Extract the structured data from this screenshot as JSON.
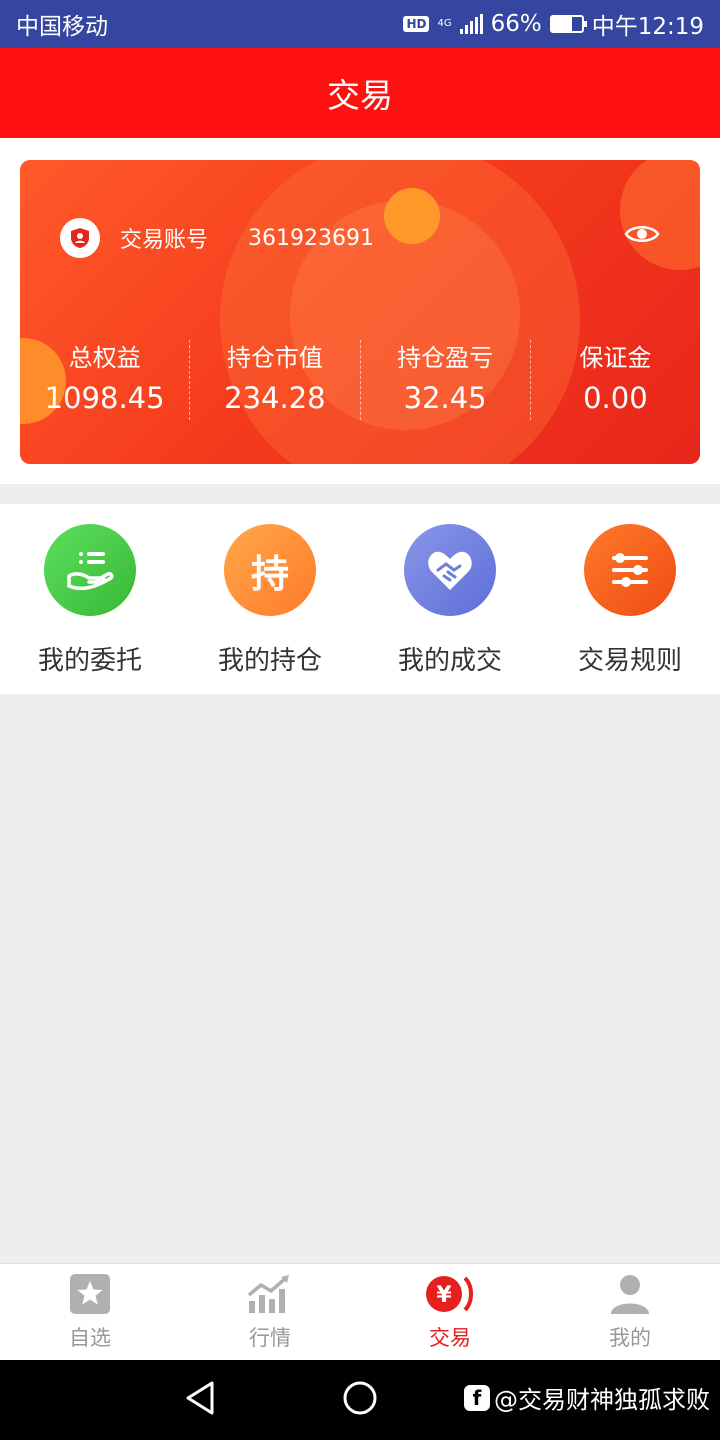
{
  "status_bar": {
    "carrier": "中国移动",
    "hd": "HD",
    "network": "4G",
    "battery": "66%",
    "battery_level": 0.66,
    "time": "中午12:19"
  },
  "header": {
    "title": "交易"
  },
  "account": {
    "label": "交易账号",
    "number": "361923691",
    "stats": [
      {
        "label": "总权益",
        "value": "1098.45"
      },
      {
        "label": "持仓市值",
        "value": "234.28"
      },
      {
        "label": "持仓盈亏",
        "value": "32.45"
      },
      {
        "label": "保证金",
        "value": "0.00"
      }
    ]
  },
  "shortcuts": [
    {
      "label": "我的委托",
      "icon": "hand-list-icon",
      "color": "#4ccb4c"
    },
    {
      "label": "我的持仓",
      "icon": "持",
      "color": "#ff8a3a"
    },
    {
      "label": "我的成交",
      "icon": "handshake-heart-icon",
      "color": "#6f7fdc"
    },
    {
      "label": "交易规则",
      "icon": "sliders-icon",
      "color": "#f25a1c"
    }
  ],
  "tabbar": {
    "active": "交易",
    "tabs": [
      {
        "label": "自选",
        "icon": "star-icon"
      },
      {
        "label": "行情",
        "icon": "chart-trend-icon"
      },
      {
        "label": "交易",
        "icon": "yen-icon"
      },
      {
        "label": "我的",
        "icon": "user-icon"
      }
    ]
  },
  "watermark": {
    "logo": "f",
    "text": "@交易财神独孤求败"
  },
  "colors": {
    "header": "#ff1111",
    "statusbar": "#3446a0",
    "active_tab": "#e61f1f"
  }
}
